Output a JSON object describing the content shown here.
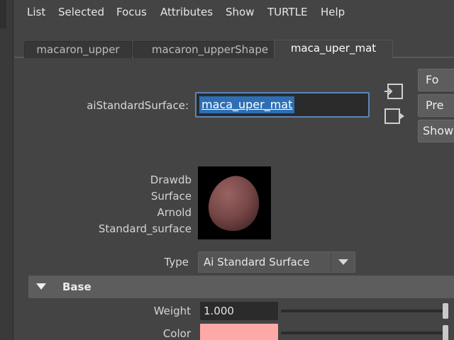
{
  "menubar": {
    "items": [
      "List",
      "Selected",
      "Focus",
      "Attributes",
      "Show",
      "TURTLE",
      "Help"
    ]
  },
  "tabs": [
    {
      "label": "macaron_upper",
      "active": false
    },
    {
      "label": "macaron_upperShape",
      "active": false
    },
    {
      "label": "maca_uper_mat",
      "active": true
    }
  ],
  "node": {
    "type_label": "aiStandardSurface:",
    "name_value": "maca_uper_mat"
  },
  "side_buttons": {
    "focus": "Fo",
    "presets": "Pre",
    "show": "Show"
  },
  "preview": {
    "labels": [
      "Drawdb",
      "Surface",
      "Arnold",
      "Standard_surface"
    ],
    "sphere_color": "#7a4a4a"
  },
  "type_field": {
    "label": "Type",
    "value": "Ai Standard Surface"
  },
  "base_section": {
    "title": "Base",
    "weight_label": "Weight",
    "weight_value": "1.000",
    "weight_slider_fraction": 1.0,
    "color_label": "Color",
    "color_value": "#ffa8a8",
    "color_slider_fraction": 1.0
  },
  "colors": {
    "selection": "#2d6fb4",
    "focus_border": "#5b86b8"
  }
}
